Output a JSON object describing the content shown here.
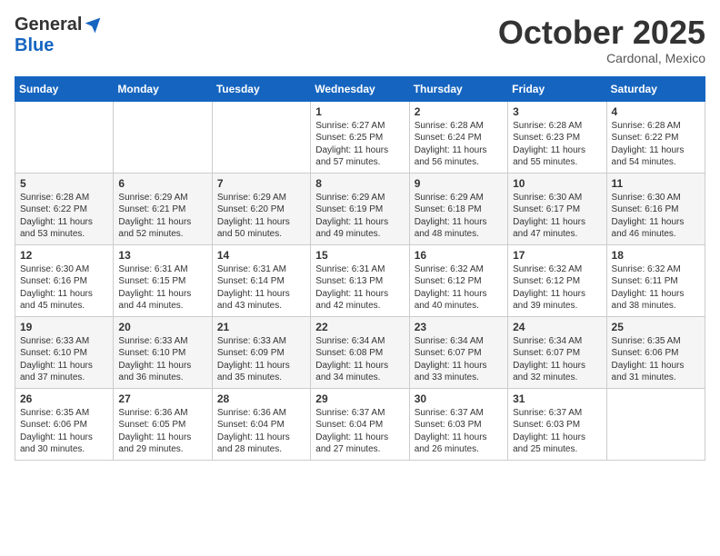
{
  "header": {
    "logo_general": "General",
    "logo_blue": "Blue",
    "month": "October 2025",
    "location": "Cardonal, Mexico"
  },
  "weekdays": [
    "Sunday",
    "Monday",
    "Tuesday",
    "Wednesday",
    "Thursday",
    "Friday",
    "Saturday"
  ],
  "weeks": [
    [
      {
        "day": "",
        "info": ""
      },
      {
        "day": "",
        "info": ""
      },
      {
        "day": "",
        "info": ""
      },
      {
        "day": "1",
        "info": "Sunrise: 6:27 AM\nSunset: 6:25 PM\nDaylight: 11 hours\nand 57 minutes."
      },
      {
        "day": "2",
        "info": "Sunrise: 6:28 AM\nSunset: 6:24 PM\nDaylight: 11 hours\nand 56 minutes."
      },
      {
        "day": "3",
        "info": "Sunrise: 6:28 AM\nSunset: 6:23 PM\nDaylight: 11 hours\nand 55 minutes."
      },
      {
        "day": "4",
        "info": "Sunrise: 6:28 AM\nSunset: 6:22 PM\nDaylight: 11 hours\nand 54 minutes."
      }
    ],
    [
      {
        "day": "5",
        "info": "Sunrise: 6:28 AM\nSunset: 6:22 PM\nDaylight: 11 hours\nand 53 minutes."
      },
      {
        "day": "6",
        "info": "Sunrise: 6:29 AM\nSunset: 6:21 PM\nDaylight: 11 hours\nand 52 minutes."
      },
      {
        "day": "7",
        "info": "Sunrise: 6:29 AM\nSunset: 6:20 PM\nDaylight: 11 hours\nand 50 minutes."
      },
      {
        "day": "8",
        "info": "Sunrise: 6:29 AM\nSunset: 6:19 PM\nDaylight: 11 hours\nand 49 minutes."
      },
      {
        "day": "9",
        "info": "Sunrise: 6:29 AM\nSunset: 6:18 PM\nDaylight: 11 hours\nand 48 minutes."
      },
      {
        "day": "10",
        "info": "Sunrise: 6:30 AM\nSunset: 6:17 PM\nDaylight: 11 hours\nand 47 minutes."
      },
      {
        "day": "11",
        "info": "Sunrise: 6:30 AM\nSunset: 6:16 PM\nDaylight: 11 hours\nand 46 minutes."
      }
    ],
    [
      {
        "day": "12",
        "info": "Sunrise: 6:30 AM\nSunset: 6:16 PM\nDaylight: 11 hours\nand 45 minutes."
      },
      {
        "day": "13",
        "info": "Sunrise: 6:31 AM\nSunset: 6:15 PM\nDaylight: 11 hours\nand 44 minutes."
      },
      {
        "day": "14",
        "info": "Sunrise: 6:31 AM\nSunset: 6:14 PM\nDaylight: 11 hours\nand 43 minutes."
      },
      {
        "day": "15",
        "info": "Sunrise: 6:31 AM\nSunset: 6:13 PM\nDaylight: 11 hours\nand 42 minutes."
      },
      {
        "day": "16",
        "info": "Sunrise: 6:32 AM\nSunset: 6:12 PM\nDaylight: 11 hours\nand 40 minutes."
      },
      {
        "day": "17",
        "info": "Sunrise: 6:32 AM\nSunset: 6:12 PM\nDaylight: 11 hours\nand 39 minutes."
      },
      {
        "day": "18",
        "info": "Sunrise: 6:32 AM\nSunset: 6:11 PM\nDaylight: 11 hours\nand 38 minutes."
      }
    ],
    [
      {
        "day": "19",
        "info": "Sunrise: 6:33 AM\nSunset: 6:10 PM\nDaylight: 11 hours\nand 37 minutes."
      },
      {
        "day": "20",
        "info": "Sunrise: 6:33 AM\nSunset: 6:10 PM\nDaylight: 11 hours\nand 36 minutes."
      },
      {
        "day": "21",
        "info": "Sunrise: 6:33 AM\nSunset: 6:09 PM\nDaylight: 11 hours\nand 35 minutes."
      },
      {
        "day": "22",
        "info": "Sunrise: 6:34 AM\nSunset: 6:08 PM\nDaylight: 11 hours\nand 34 minutes."
      },
      {
        "day": "23",
        "info": "Sunrise: 6:34 AM\nSunset: 6:07 PM\nDaylight: 11 hours\nand 33 minutes."
      },
      {
        "day": "24",
        "info": "Sunrise: 6:34 AM\nSunset: 6:07 PM\nDaylight: 11 hours\nand 32 minutes."
      },
      {
        "day": "25",
        "info": "Sunrise: 6:35 AM\nSunset: 6:06 PM\nDaylight: 11 hours\nand 31 minutes."
      }
    ],
    [
      {
        "day": "26",
        "info": "Sunrise: 6:35 AM\nSunset: 6:06 PM\nDaylight: 11 hours\nand 30 minutes."
      },
      {
        "day": "27",
        "info": "Sunrise: 6:36 AM\nSunset: 6:05 PM\nDaylight: 11 hours\nand 29 minutes."
      },
      {
        "day": "28",
        "info": "Sunrise: 6:36 AM\nSunset: 6:04 PM\nDaylight: 11 hours\nand 28 minutes."
      },
      {
        "day": "29",
        "info": "Sunrise: 6:37 AM\nSunset: 6:04 PM\nDaylight: 11 hours\nand 27 minutes."
      },
      {
        "day": "30",
        "info": "Sunrise: 6:37 AM\nSunset: 6:03 PM\nDaylight: 11 hours\nand 26 minutes."
      },
      {
        "day": "31",
        "info": "Sunrise: 6:37 AM\nSunset: 6:03 PM\nDaylight: 11 hours\nand 25 minutes."
      },
      {
        "day": "",
        "info": ""
      }
    ]
  ]
}
